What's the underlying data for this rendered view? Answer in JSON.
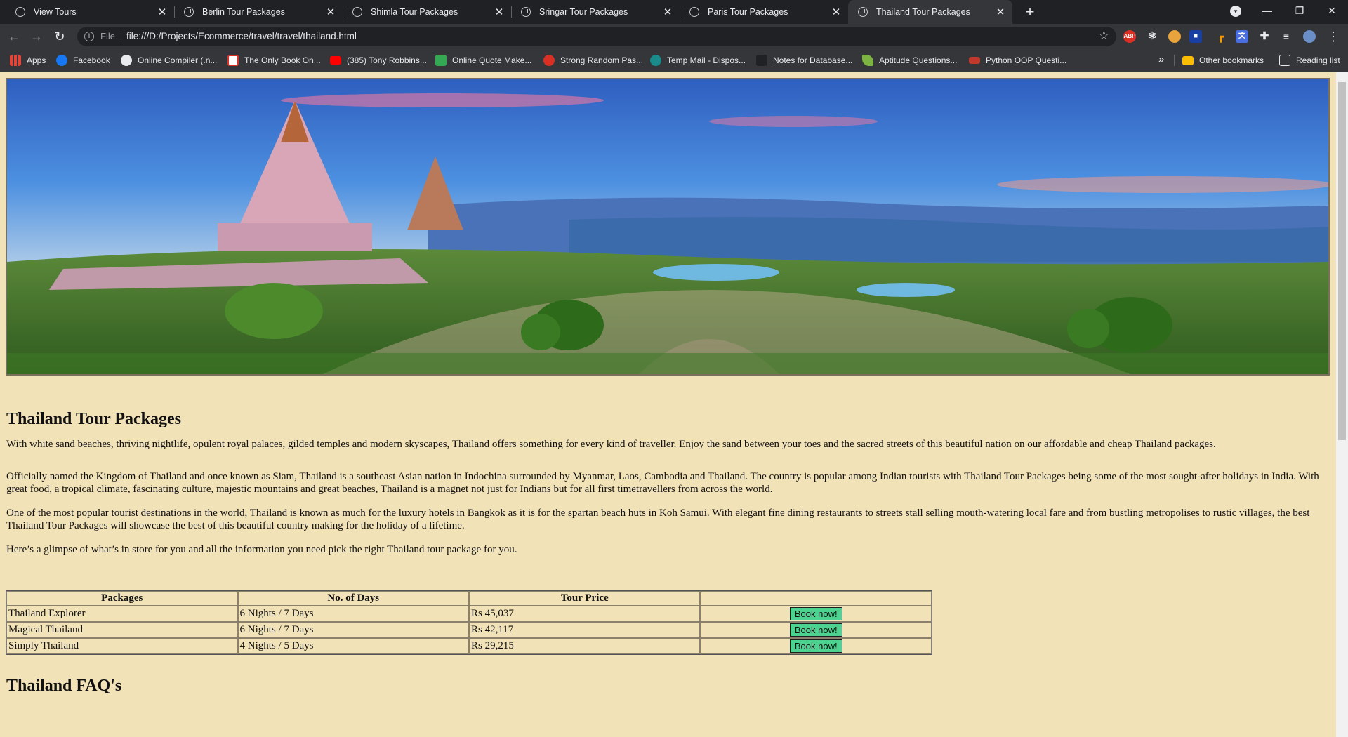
{
  "browser": {
    "tabs": [
      {
        "title": "View Tours",
        "active": false
      },
      {
        "title": "Berlin Tour Packages",
        "active": false
      },
      {
        "title": "Shimla Tour Packages",
        "active": false
      },
      {
        "title": "Sringar Tour Packages",
        "active": false
      },
      {
        "title": "Paris Tour Packages",
        "active": false
      },
      {
        "title": "Thailand Tour Packages",
        "active": true
      }
    ],
    "address": {
      "scheme_label": "File",
      "url": "file:///D:/Projects/Ecommerce/travel/travel/thailand.html"
    },
    "bookmarks": [
      {
        "label": "Apps",
        "icon": "apps-grid-icon",
        "color": "#e8eaed"
      },
      {
        "label": "Facebook",
        "icon": "facebook-icon",
        "color": "#1877f2"
      },
      {
        "label": "Online Compiler (.n...",
        "icon": "compiler-icon",
        "color": "#e8eaed"
      },
      {
        "label": "The Only Book On...",
        "icon": "book-icon",
        "color": "#d93025"
      },
      {
        "label": "(385) Tony Robbins...",
        "icon": "youtube-icon",
        "color": "#ff0000"
      },
      {
        "label": "Online Quote Make...",
        "icon": "quote-icon",
        "color": "#34a853"
      },
      {
        "label": "Strong Random Pas...",
        "icon": "password-icon",
        "color": "#d93025"
      },
      {
        "label": "Temp Mail - Dispos...",
        "icon": "mail-icon",
        "color": "#1a73e8"
      },
      {
        "label": "Notes for Database...",
        "icon": "notes-icon",
        "color": "#202124"
      },
      {
        "label": "Aptitude Questions...",
        "icon": "aptitude-icon",
        "color": "#7cb342"
      },
      {
        "label": "Python OOP Questi...",
        "icon": "python-icon",
        "color": "#c0392b"
      }
    ],
    "other_bookmarks": "Other bookmarks",
    "reading_list": "Reading list",
    "overflow": "»"
  },
  "page": {
    "title": "Thailand Tour Packages",
    "paragraphs": [
      "With white sand beaches, thriving nightlife, opulent royal palaces, gilded temples and modern skyscapes, Thailand offers something for every kind of traveller. Enjoy the sand between your toes and the sacred streets of this beautiful nation on our affordable and cheap Thailand packages.",
      "Officially named the Kingdom of Thailand and once known as Siam, Thailand is a southeast Asian nation in Indochina surrounded by Myanmar, Laos, Cambodia and Thailand. The country is popular among Indian tourists with Thailand Tour Packages being some of the most sought-after holidays in India. With great food, a tropical climate, fascinating culture, majestic mountains and great beaches, Thailand is a magnet not just for Indians but for all first timetravellers from across the world.",
      "One of the most popular tourist destinations in the world, Thailand is known as much for the luxury hotels in Bangkok as it is for the spartan beach huts in Koh Samui. With elegant fine dining restaurants to streets stall selling mouth-watering local fare and from bustling metropolises to rustic villages, the best Thailand Tour Packages will showcase the best of this beautiful country making for the holiday of a lifetime.",
      "Here’s a glimpse of what’s in store for you and all the information you need pick the right Thailand tour package for you."
    ],
    "table": {
      "headers": [
        "Packages",
        "No. of Days",
        "Tour Price",
        ""
      ],
      "rows": [
        {
          "name": "Thailand Explorer",
          "days": "6 Nights / 7 Days",
          "price": "Rs 45,037",
          "button": "Book now!"
        },
        {
          "name": "Magical Thailand",
          "days": "6 Nights / 7 Days",
          "price": "Rs 42,117",
          "button": "Book now!"
        },
        {
          "name": "Simply Thailand",
          "days": "4 Nights / 5 Days",
          "price": "Rs 29,215",
          "button": "Book now!"
        }
      ]
    },
    "faq_title": "Thailand FAQ's"
  },
  "colors": {
    "page_background": "#f2e2b8",
    "book_button": "#4cd38f",
    "browser_dark": "#202124",
    "browser_toolbar": "#35363a"
  }
}
